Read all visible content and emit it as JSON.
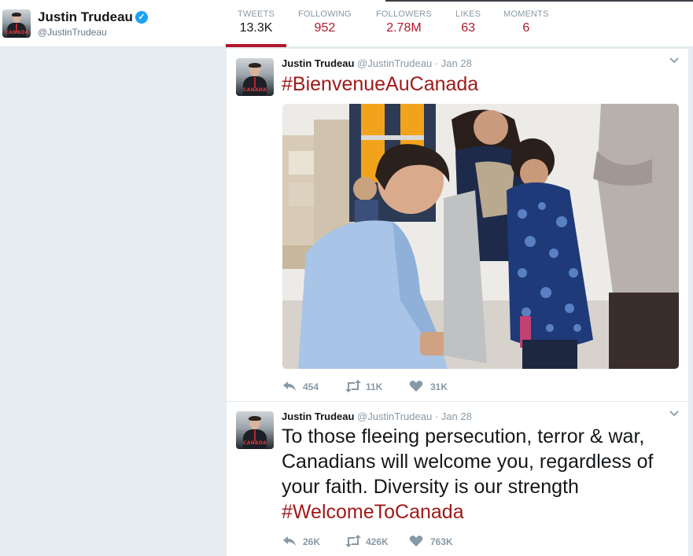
{
  "profile": {
    "name": "Justin Trudeau",
    "handle": "@JustinTrudeau",
    "avatar_tag": "CANADA",
    "verified_icon": "✓"
  },
  "stats": [
    {
      "label": "TWEETS",
      "value": "13.3K",
      "active": true
    },
    {
      "label": "FOLLOWING",
      "value": "952",
      "active": false
    },
    {
      "label": "FOLLOWERS",
      "value": "2.78M",
      "active": false
    },
    {
      "label": "LIKES",
      "value": "63",
      "active": false
    },
    {
      "label": "MOMENTS",
      "value": "6",
      "active": false
    }
  ],
  "tweets": [
    {
      "name": "Justin Trudeau",
      "handle": "@JustinTrudeau",
      "separator": "·",
      "date": "Jan 28",
      "hashtag": "#BienvenueAuCanada",
      "has_photo": true,
      "replies": "454",
      "retweets": "11K",
      "likes": "31K"
    },
    {
      "name": "Justin Trudeau",
      "handle": "@JustinTrudeau",
      "separator": "·",
      "date": "Jan 28",
      "text": "To those fleeing persecution, terror & war, Canadians will welcome you, regardless of your faith. Diversity is our strength",
      "hashtag": "#WelcomeToCanada",
      "replies": "26K",
      "retweets": "426K",
      "likes": "763K"
    }
  ],
  "colors": {
    "accent": "#b0172b",
    "hashtag": "#a01a1a",
    "muted": "#8899a6",
    "verified": "#1da1f2"
  },
  "icons": {
    "reply": "reply-icon",
    "retweet": "retweet-icon",
    "like": "heart-icon",
    "caret": "chevron-down-icon"
  }
}
